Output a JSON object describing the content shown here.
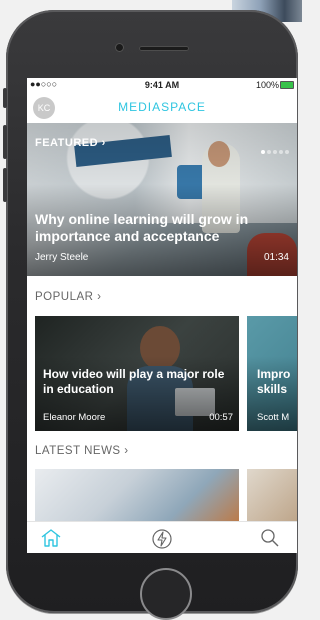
{
  "status": {
    "carrier": "●●○○○",
    "time": "9:41 AM",
    "battery": "100%"
  },
  "header": {
    "avatar_initials": "KC",
    "title": "MEDIASPACE"
  },
  "featured": {
    "label": "FEATURED",
    "title": "Why online learning will grow in importance and acceptance",
    "author": "Jerry Steele",
    "duration": "01:34"
  },
  "popular": {
    "header": "POPULAR",
    "cards": [
      {
        "title": "How video will play a major role in education",
        "author": "Eleanor Moore",
        "duration": "00:57"
      },
      {
        "title": "Impro skills",
        "author": "Scott M"
      }
    ]
  },
  "latest_news": {
    "header": "LATEST NEWS"
  },
  "tabs": {
    "home": "home-icon",
    "bolt": "bolt-icon",
    "search": "search-icon"
  },
  "colors": {
    "accent": "#2fc5e0"
  }
}
